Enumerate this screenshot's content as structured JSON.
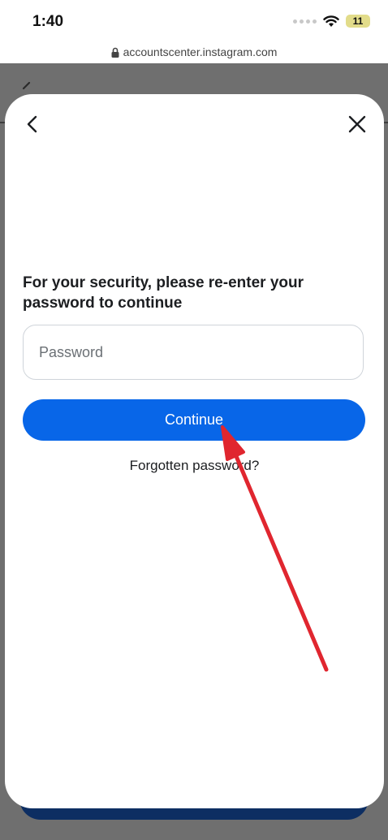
{
  "status_bar": {
    "time": "1:40",
    "battery": "11"
  },
  "browser": {
    "url": "accountscenter.instagram.com"
  },
  "icons": {
    "lock": "lock-icon",
    "wifi": "wifi-icon",
    "back": "chevron-left-icon",
    "close": "close-icon"
  },
  "modal": {
    "prompt": "For your security, please re-enter your password to continue",
    "password_placeholder": "Password",
    "password_value": "",
    "continue_label": "Continue",
    "forgot_label": "Forgotten password?"
  },
  "colors": {
    "accent": "#0866e8",
    "annotation_arrow": "#e0262f",
    "overlay": "#6f6f6f"
  }
}
